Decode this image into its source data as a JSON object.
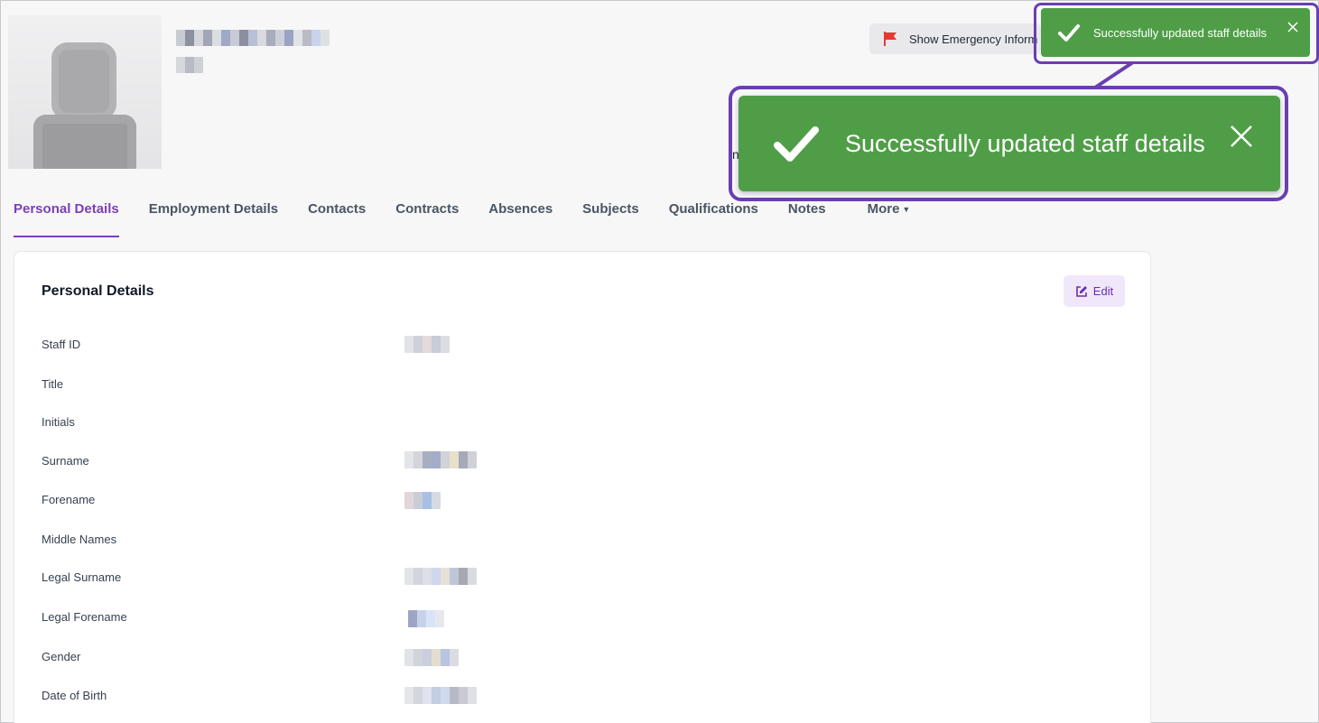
{
  "header": {
    "emergency_button_label": "Show Emergency Inform",
    "partial_text": "n"
  },
  "toast_small": {
    "message": "Successfully updated staff details"
  },
  "toast_big": {
    "message": "Successfully updated staff details"
  },
  "tabs": [
    {
      "label": "Personal Details",
      "active": true
    },
    {
      "label": "Employment Details"
    },
    {
      "label": "Contacts"
    },
    {
      "label": "Contracts"
    },
    {
      "label": "Absences"
    },
    {
      "label": "Subjects"
    },
    {
      "label": "Qualifications"
    },
    {
      "label": "Notes"
    },
    {
      "label": "More"
    }
  ],
  "card": {
    "title": "Personal Details",
    "edit_label": "Edit",
    "fields": [
      {
        "label": "Staff ID"
      },
      {
        "label": "Title"
      },
      {
        "label": "Initials"
      },
      {
        "label": "Surname"
      },
      {
        "label": "Forename"
      },
      {
        "label": "Middle Names"
      },
      {
        "label": "Legal Surname"
      },
      {
        "label": "Legal Forename"
      },
      {
        "label": "Gender"
      },
      {
        "label": "Date of Birth"
      }
    ]
  },
  "colors": {
    "accent": "#7b3fb8",
    "toast_green": "#4f9e47",
    "highlight_frame": "#6a3fb0",
    "flag_red": "#e53935"
  }
}
